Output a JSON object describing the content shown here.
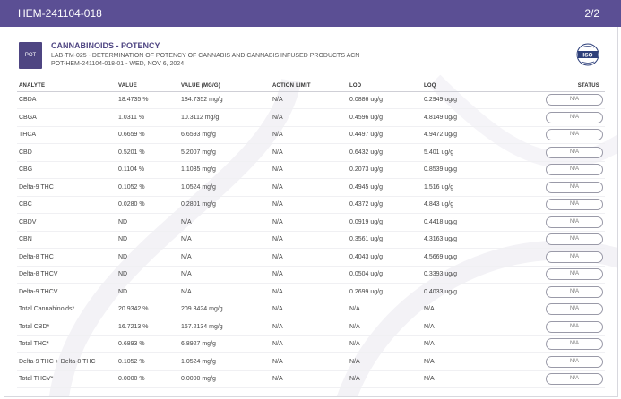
{
  "topbar": {
    "report_id": "HEM-241104-018",
    "page": "2/2"
  },
  "header": {
    "badge": "POT",
    "title": "CANNABINOIDS - POTENCY",
    "method": "LAB-TM-025 - DETERMINATION OF POTENCY OF CANNABIS AND CANNABIS INFUSED PRODUCTS ACN",
    "sample": "POT-HEM-241104-018-01 - WED, NOV 6, 2024",
    "iso_text": "ISO",
    "iso_icon": "iso-accreditation-icon"
  },
  "colors": {
    "brand": "#5b4f94",
    "badge": "#4e4582"
  },
  "table": {
    "headers": [
      "ANALYTE",
      "VALUE",
      "VALUE (MG/G)",
      "ACTION LIMIT",
      "LOD",
      "LOQ",
      "STATUS"
    ],
    "rows": [
      [
        "CBDA",
        "18.4735 %",
        "184.7352 mg/g",
        "N/A",
        "0.0886 ug/g",
        "0.2949 ug/g",
        "N/A"
      ],
      [
        "CBGA",
        "1.0311 %",
        "10.3112 mg/g",
        "N/A",
        "0.4596 ug/g",
        "4.8149 ug/g",
        "N/A"
      ],
      [
        "THCA",
        "0.6659 %",
        "6.6593 mg/g",
        "N/A",
        "0.4497 ug/g",
        "4.9472 ug/g",
        "N/A"
      ],
      [
        "CBD",
        "0.5201 %",
        "5.2007 mg/g",
        "N/A",
        "0.6432 ug/g",
        "5.401 ug/g",
        "N/A"
      ],
      [
        "CBG",
        "0.1104 %",
        "1.1035 mg/g",
        "N/A",
        "0.2073 ug/g",
        "0.8539 ug/g",
        "N/A"
      ],
      [
        "Delta-9 THC",
        "0.1052 %",
        "1.0524 mg/g",
        "N/A",
        "0.4945 ug/g",
        "1.516 ug/g",
        "N/A"
      ],
      [
        "CBC",
        "0.0280 %",
        "0.2801 mg/g",
        "N/A",
        "0.4372 ug/g",
        "4.843 ug/g",
        "N/A"
      ],
      [
        "CBDV",
        "ND",
        "N/A",
        "N/A",
        "0.0919 ug/g",
        "0.4418 ug/g",
        "N/A"
      ],
      [
        "CBN",
        "ND",
        "N/A",
        "N/A",
        "0.3561 ug/g",
        "4.3163 ug/g",
        "N/A"
      ],
      [
        "Delta-8 THC",
        "ND",
        "N/A",
        "N/A",
        "0.4043 ug/g",
        "4.5669 ug/g",
        "N/A"
      ],
      [
        "Delta-8 THCV",
        "ND",
        "N/A",
        "N/A",
        "0.0504 ug/g",
        "0.3393 ug/g",
        "N/A"
      ],
      [
        "Delta-9 THCV",
        "ND",
        "N/A",
        "N/A",
        "0.2699 ug/g",
        "0.4033 ug/g",
        "N/A"
      ],
      [
        "Total Cannabinoids*",
        "20.9342 %",
        "209.3424 mg/g",
        "N/A",
        "N/A",
        "N/A",
        "N/A"
      ],
      [
        "Total CBD*",
        "16.7213 %",
        "167.2134 mg/g",
        "N/A",
        "N/A",
        "N/A",
        "N/A"
      ],
      [
        "Total THC*",
        "0.6893 %",
        "6.8927 mg/g",
        "N/A",
        "N/A",
        "N/A",
        "N/A"
      ],
      [
        "Delta-9 THC + Delta-8 THC",
        "0.1052 %",
        "1.0524 mg/g",
        "N/A",
        "N/A",
        "N/A",
        "N/A"
      ],
      [
        "Total THCV*",
        "0.0000 %",
        "0.0000 mg/g",
        "N/A",
        "N/A",
        "N/A",
        "N/A"
      ]
    ]
  }
}
